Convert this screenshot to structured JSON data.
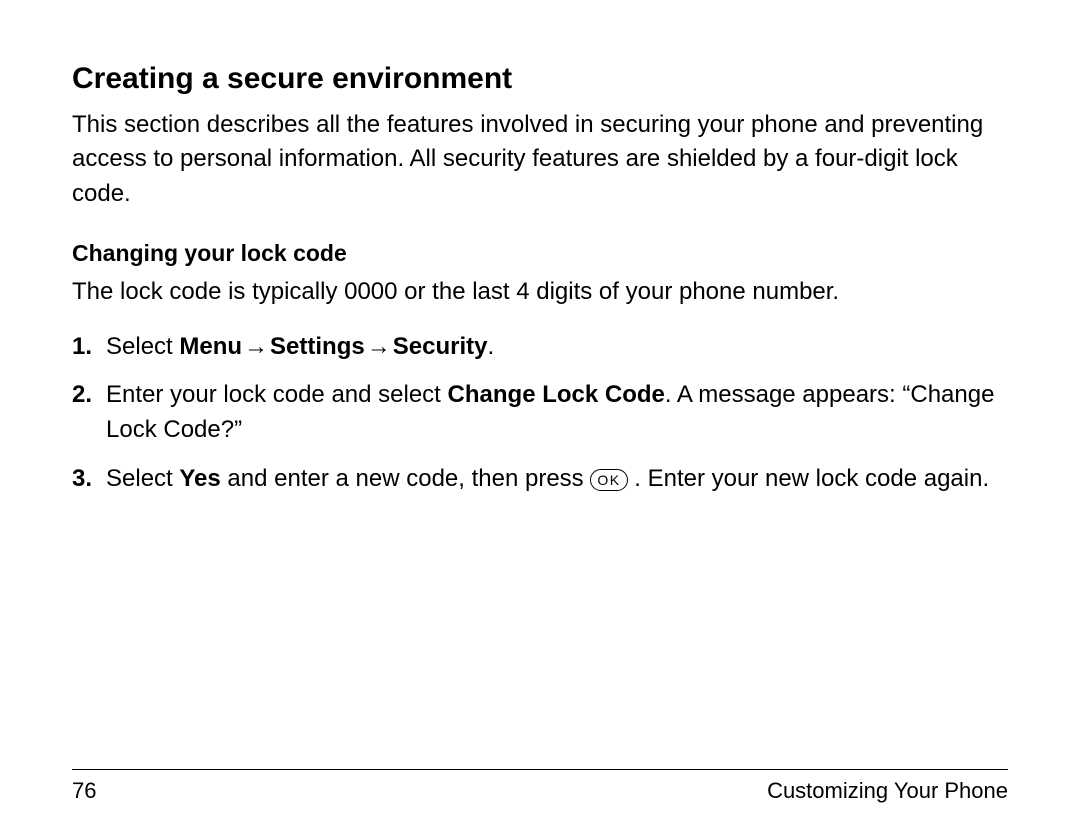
{
  "heading": "Creating a secure environment",
  "intro": "This section describes all the features involved in securing your phone and preventing access to personal information. All security features are shielded by a four-digit lock code.",
  "subheading": "Changing your lock code",
  "sub_intro": "The lock code is typically 0000 or the last 4 digits of your phone number.",
  "steps": {
    "s1": {
      "num": "1.",
      "pre": "Select ",
      "menu": "Menu",
      "arrow": "→",
      "settings": "Settings",
      "security": "Security",
      "period": "."
    },
    "s2": {
      "num": "2.",
      "pre": "Enter your lock code and select ",
      "bold": "Change Lock Code",
      "post": ". A message appears: “Change Lock Code?”"
    },
    "s3": {
      "num": "3.",
      "pre": "Select ",
      "yes": "Yes",
      "mid": " and enter a new code, then press ",
      "ok": "OK",
      "post": " . Enter your new lock code again."
    }
  },
  "footer": {
    "page": "76",
    "section": "Customizing Your Phone"
  }
}
